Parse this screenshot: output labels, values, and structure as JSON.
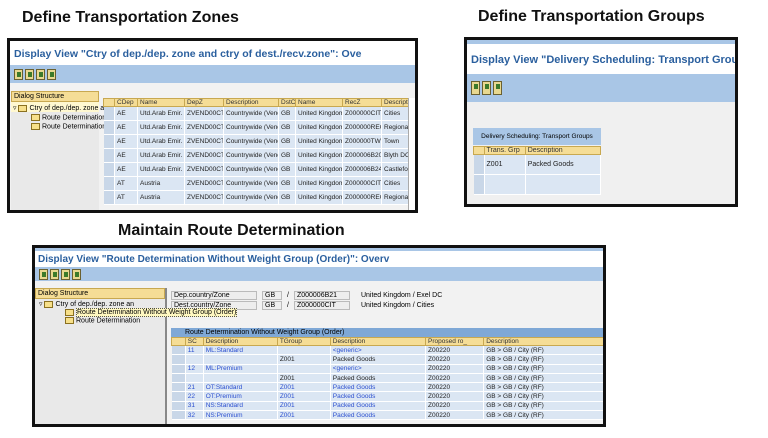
{
  "headings": {
    "zones": "Define Transportation Zones",
    "groups": "Define Transportation Groups",
    "route": "Maintain Route Determination"
  },
  "zones": {
    "title": "Display View \"Ctry of dep./dep. zone and ctry of dest./recv.zone\": Ove",
    "dialog_structure": "Dialog Structure",
    "tree": [
      "Ctry of dep./dep. zone an",
      "Route Determination",
      "Route Determination"
    ],
    "columns": [
      "CDep",
      "Name",
      "DepZ",
      "Description",
      "DstC",
      "Name",
      "RecZ",
      "Description"
    ],
    "rows": [
      [
        "AE",
        "Utd.Arab Emir.",
        "ZVEND00CTW",
        "Countrywide (Vendor)",
        "GB",
        "United Kingdom",
        "Z000000CIT",
        "Cities"
      ],
      [
        "AE",
        "Utd.Arab Emir.",
        "ZVEND00CTW",
        "Countrywide (Vendor)",
        "GB",
        "United Kingdom",
        "Z000000REG",
        "Regional"
      ],
      [
        "AE",
        "Utd.Arab Emir.",
        "ZVEND00CTW",
        "Countrywide (Vendor)",
        "GB",
        "United Kingdom",
        "Z000000TWN",
        "Town"
      ],
      [
        "AE",
        "Utd.Arab Emir.",
        "ZVEND00CTW",
        "Countrywide (Vendor)",
        "GB",
        "United Kingdom",
        "Z000006B20",
        "Blyth DC"
      ],
      [
        "AE",
        "Utd.Arab Emir.",
        "ZVEND00CTW",
        "Countrywide (Vendor)",
        "GB",
        "United Kingdom",
        "Z000006B24",
        "Castleford Manu"
      ],
      [
        "AT",
        "Austria",
        "ZVEND00CTW",
        "Countrywide (Vendor)",
        "GB",
        "United Kingdom",
        "Z000000CIT",
        "Cities"
      ],
      [
        "AT",
        "Austria",
        "ZVEND00CTW",
        "Countrywide (Vendor)",
        "GB",
        "United Kingdom",
        "Z000000REG",
        "Regional"
      ]
    ]
  },
  "groups": {
    "title": "Display View \"Delivery Scheduling: Transport Groups\":",
    "table_title": "Delivery Scheduling: Transport Groups",
    "columns": [
      "Trans. Grp",
      "Description"
    ],
    "rows": [
      [
        "Z001",
        "Packed Goods"
      ],
      [
        "",
        ""
      ]
    ]
  },
  "route": {
    "title": "Display View \"Route Determination Without Weight Group (Order)\": Overv",
    "dialog_structure": "Dialog Structure",
    "tree": [
      "Ctry of dep./dep. zone an",
      "Route Determination Without Weight Group (Order)",
      "Route Determination"
    ],
    "fields": [
      {
        "label": "Dep.country/Zone",
        "country": "GB",
        "zone": "Z000006B21",
        "text": "United Kingdom / Exel DC"
      },
      {
        "label": "Dest.country/Zone",
        "country": "GB",
        "zone": "Z000000CIT",
        "text": "United Kingdom / Cities"
      }
    ],
    "sep": "/",
    "table_title": "Route Determination Without Weight Group (Order)",
    "columns": [
      "SC",
      "Description",
      "TGroup",
      "Description",
      "Proposed ro_",
      "Description"
    ],
    "rows": [
      [
        "11",
        "ML:Standard",
        "",
        "<generic>",
        "Z00220",
        "GB > GB / City (RF)"
      ],
      [
        "",
        "",
        "Z001",
        "Packed Goods",
        "Z00220",
        "GB > GB / City (RF)"
      ],
      [
        "12",
        "ML:Premium",
        "",
        "<generic>",
        "Z00220",
        "GB > GB / City (RF)"
      ],
      [
        "",
        "",
        "Z001",
        "Packed Goods",
        "Z00220",
        "GB > GB / City (RF)"
      ],
      [
        "21",
        "OT:Standard",
        "Z001",
        "Packed Goods",
        "Z00220",
        "GB > GB / City (RF)"
      ],
      [
        "22",
        "OT:Premium",
        "Z001",
        "Packed Goods",
        "Z00220",
        "GB > GB / City (RF)"
      ],
      [
        "31",
        "NS:Standard",
        "Z001",
        "Packed Goods",
        "Z00220",
        "GB > GB / City (RF)"
      ],
      [
        "32",
        "NS:Premium",
        "Z001",
        "Packed Goods",
        "Z00220",
        "GB > GB / City (RF)"
      ]
    ]
  }
}
